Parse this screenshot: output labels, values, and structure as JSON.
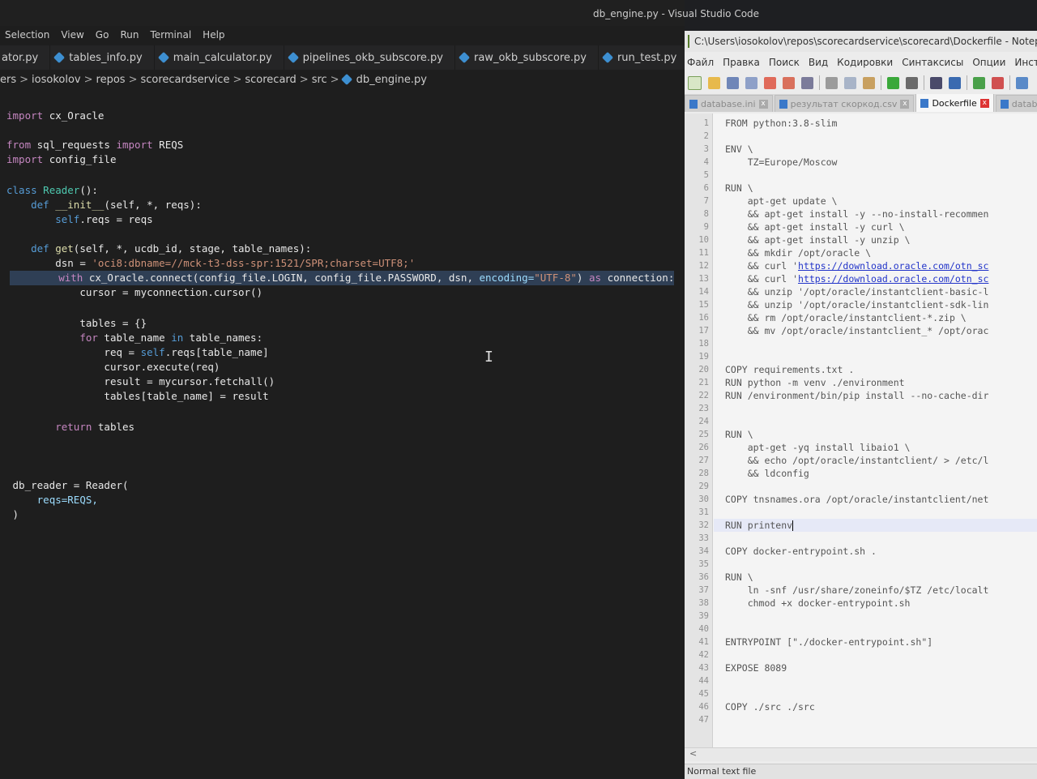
{
  "vscode": {
    "title": "db_engine.py - Visual Studio Code",
    "menu": [
      "Selection",
      "View",
      "Go",
      "Run",
      "Terminal",
      "Help"
    ],
    "tabs": [
      "ator.py",
      "tables_info.py",
      "main_calculator.py",
      "pipelines_okb_subscore.py",
      "raw_okb_subscore.py",
      "run_test.py"
    ],
    "breadcrumb": [
      "ers",
      "iosokolov",
      "repos",
      "scorecardservice",
      "scorecard",
      "src",
      "db_engine.py"
    ],
    "code": {
      "import_cx": "cx_Oracle",
      "from_mod": "sql_requests",
      "from_name": "REQS",
      "import_cfg": "config_file",
      "class_name": "Reader",
      "init_name": "__init__",
      "init_params": "(self, *, reqs):",
      "self_reqs": ".reqs = reqs",
      "get_name": "get",
      "get_params": "(self, *, ucdb_id, stage, table_names):",
      "dsn_assign": "dsn = ",
      "dsn_value": "'oci8:dbname=//mck-t3-dss-spr:1521/SPR;charset=UTF8;'",
      "with_call": " cx_Oracle.connect(config_file.LOGIN, config_file.PASSWORD, dsn, ",
      "with_encoding_kw": "encoding=",
      "with_encoding_val": "\"UTF-8\"",
      "with_as": " as ",
      "with_target": "connection:",
      "cursor_line": "cursor = myconnection.cursor()",
      "tables_line": "tables = {}",
      "for_var": " table_name ",
      "for_iter": " table_names:",
      "req_assign": "req = ",
      "req_rhs": ".reqs[table_name]",
      "execute_line": "cursor.execute(req)",
      "result_line": "result = mycursor.fetchall()",
      "tables_set": "tables[table_name] = result",
      "return_val": " tables",
      "db_reader": "db_reader = Reader(",
      "reqs_kw": "reqs=REQS,",
      "close_paren": ")"
    }
  },
  "notepad": {
    "title": "C:\\Users\\iosokolov\\repos\\scorecardservice\\scorecard\\Dockerfile - Notepad",
    "menu": [
      "Файл",
      "Правка",
      "Поиск",
      "Вид",
      "Кодировки",
      "Синтаксисы",
      "Опции",
      "Инстр"
    ],
    "tabs": [
      "database.ini",
      "результат скоркод.csv",
      "Dockerfile",
      "database.ini"
    ],
    "status": "Normal text file",
    "lines": [
      "FROM python:3.8-slim",
      "",
      "ENV \\",
      "    TZ=Europe/Moscow",
      "",
      "RUN \\",
      "    apt-get update \\",
      "    && apt-get install -y --no-install-recommen",
      "    && apt-get install -y curl \\",
      "    && apt-get install -y unzip \\",
      "    && mkdir /opt/oracle \\",
      "    && curl 'https://download.oracle.com/otn_sc",
      "    && curl 'https://download.oracle.com/otn_sc",
      "    && unzip '/opt/oracle/instantclient-basic-l",
      "    && unzip '/opt/oracle/instantclient-sdk-lin",
      "    && rm /opt/oracle/instantclient-*.zip \\",
      "    && mv /opt/oracle/instantclient_* /opt/orac",
      "",
      "",
      "COPY requirements.txt .",
      "RUN python -m venv ./environment",
      "RUN /environment/bin/pip install --no-cache-dir",
      "",
      "",
      "RUN \\",
      "    apt-get -yq install libaio1 \\",
      "    && echo /opt/oracle/instantclient/ > /etc/l",
      "    && ldconfig",
      "",
      "COPY tnsnames.ora /opt/oracle/instantclient/net",
      "",
      "RUN printenv",
      "",
      "COPY docker-entrypoint.sh .",
      "",
      "RUN \\",
      "    ln -snf /usr/share/zoneinfo/$TZ /etc/localt",
      "    chmod +x docker-entrypoint.sh",
      "",
      "",
      "ENTRYPOINT [\"./docker-entrypoint.sh\"]",
      "",
      "EXPOSE 8089",
      "",
      "",
      "COPY ./src ./src",
      ""
    ]
  }
}
